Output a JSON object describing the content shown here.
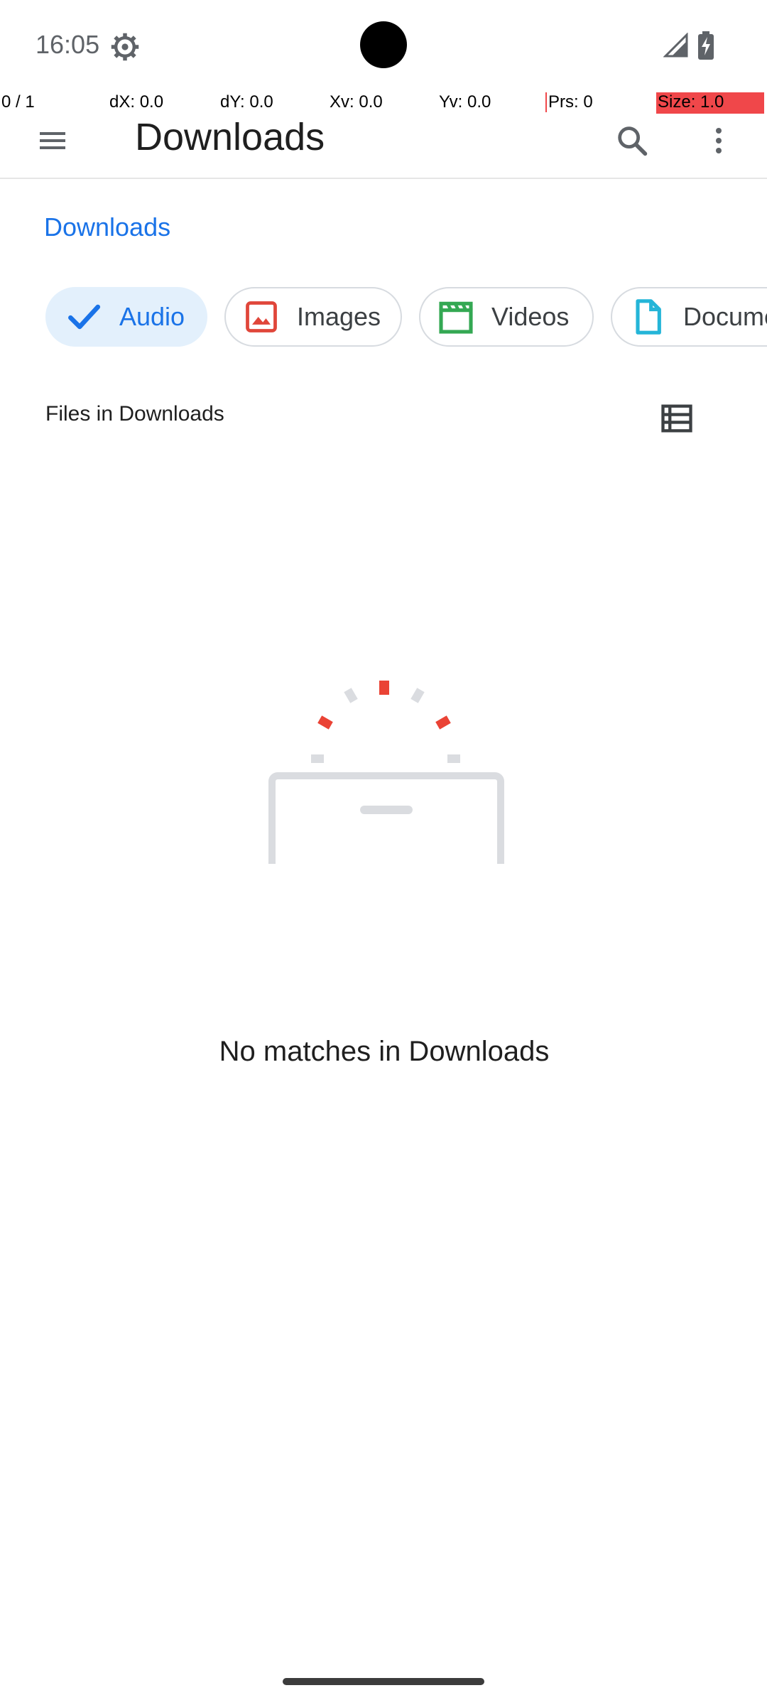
{
  "status_bar": {
    "time": "16:05"
  },
  "pointer_overlay": {
    "pointer_count": "0 / 1",
    "dx": "dX: 0.0",
    "dy": "dY: 0.0",
    "xv": "Xv: 0.0",
    "yv": "Yv: 0.0",
    "prs": "Prs: 0",
    "size": "Size: 1.0"
  },
  "app_bar": {
    "title": "Downloads",
    "menu_icon": "hamburger-menu-icon",
    "search_icon": "search-icon",
    "more_icon": "more-vert-icon"
  },
  "breadcrumb": {
    "current": "Downloads"
  },
  "filter_chips": [
    {
      "label": "Audio",
      "icon": "check-icon",
      "selected": true
    },
    {
      "label": "Images",
      "icon": "image-icon",
      "color": "#e0463a"
    },
    {
      "label": "Videos",
      "icon": "movie-icon",
      "color": "#34a853"
    },
    {
      "label": "Documents",
      "icon": "document-icon",
      "color": "#24b5d8"
    }
  ],
  "section": {
    "title": "Files in Downloads",
    "view_toggle_icon": "list-view-icon"
  },
  "empty_state": {
    "message": "No matches in Downloads"
  },
  "colors": {
    "accent": "#1a73e8",
    "chip_selected_bg": "#e3f0fc",
    "loading_red": "#ea4335",
    "loading_grey": "#dadce0"
  }
}
